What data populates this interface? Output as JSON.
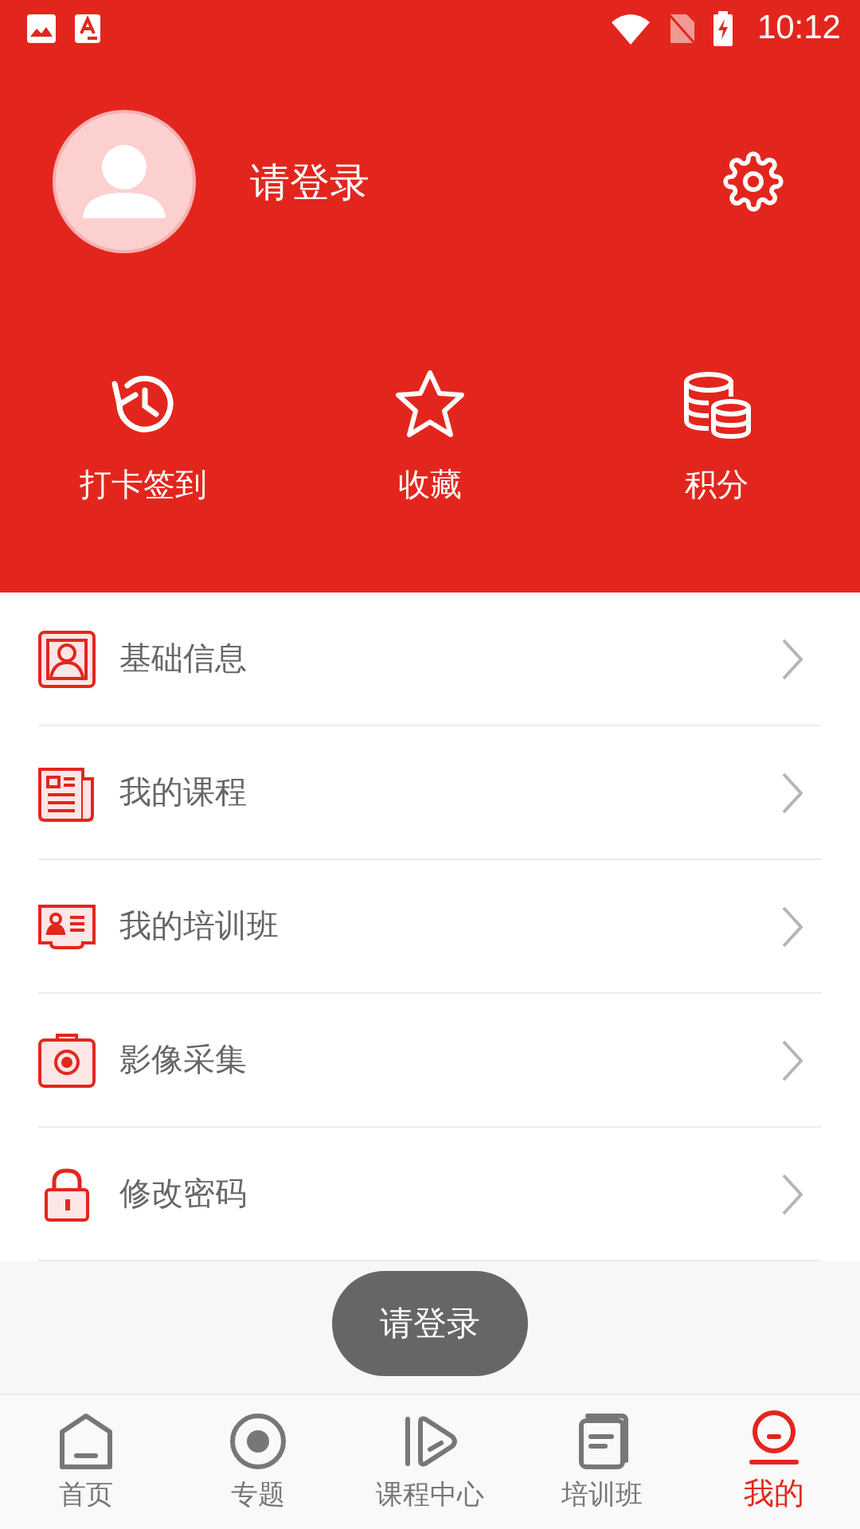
{
  "status_bar": {
    "time": "10:12"
  },
  "profile": {
    "login_prompt": "请登录"
  },
  "shortcuts": [
    {
      "label": "打卡签到"
    },
    {
      "label": "收藏"
    },
    {
      "label": "积分"
    }
  ],
  "menu": [
    {
      "label": "基础信息"
    },
    {
      "label": "我的课程"
    },
    {
      "label": "我的培训班"
    },
    {
      "label": "影像采集"
    },
    {
      "label": "修改密码"
    }
  ],
  "toast": "请登录",
  "bottom_nav": [
    {
      "label": "首页",
      "selected": false
    },
    {
      "label": "专题",
      "selected": false
    },
    {
      "label": "课程中心",
      "selected": false
    },
    {
      "label": "培训班",
      "selected": false
    },
    {
      "label": "我的",
      "selected": true
    }
  ]
}
